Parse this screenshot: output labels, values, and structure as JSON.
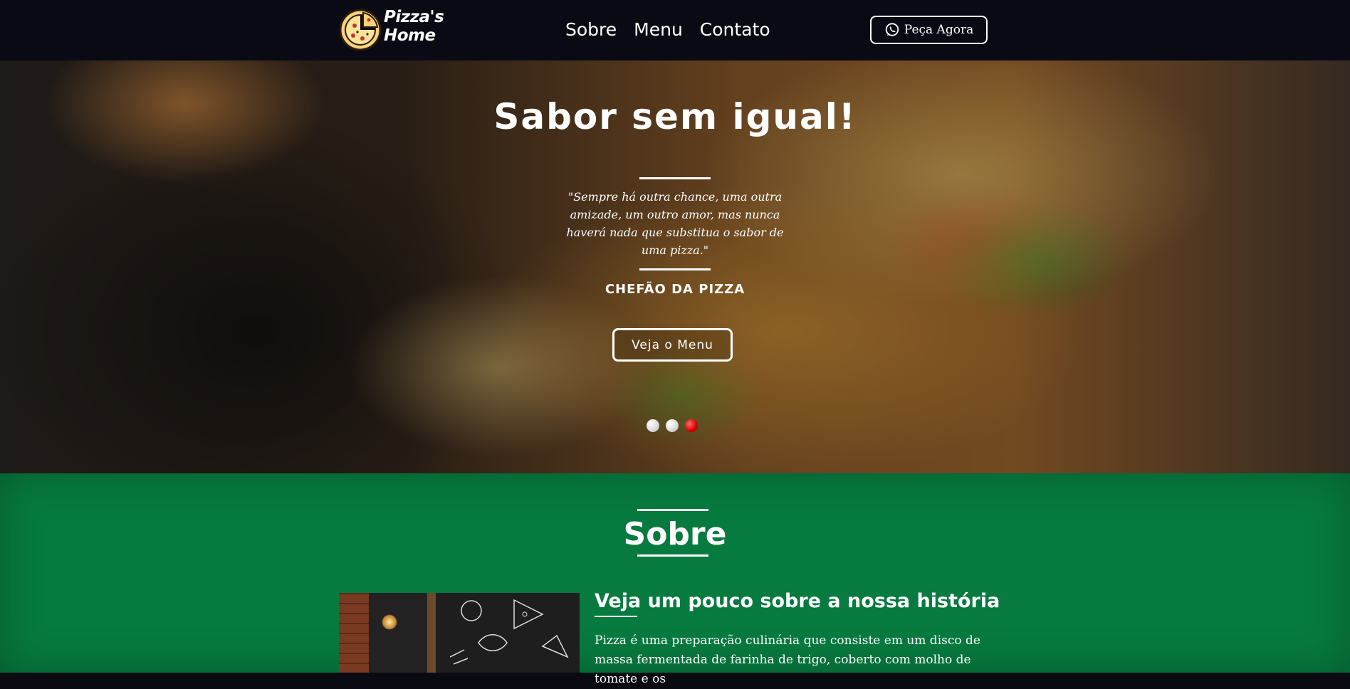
{
  "brand": {
    "line1": "Pizza's",
    "line2": "Home"
  },
  "nav": {
    "links": [
      "Sobre",
      "Menu",
      "Contato"
    ],
    "order_label": "Peça Agora"
  },
  "hero": {
    "title": "Sabor sem igual!",
    "quote": "\"Sempre há outra chance, uma outra amizade, um outro amor, mas nunca haverá nada que substitua o sabor de uma pizza.\"",
    "author": "CHEFÃO DA PIZZA",
    "cta": "Veja o Menu",
    "slides_total": 3,
    "active_slide": 3
  },
  "sobre": {
    "title": "Sobre",
    "subtitle": "Veja um pouco sobre a nossa história",
    "text": "Pizza é uma preparação culinária que consiste em um disco de massa fermentada de farinha de trigo, coberto com molho de tomate e os"
  },
  "colors": {
    "nav_bg": "#0a0a14",
    "section_green": "#077a3f",
    "active_dot": "#d60000"
  },
  "icons": {
    "logo": "pizza-logo-icon",
    "order": "whatsapp-icon"
  }
}
